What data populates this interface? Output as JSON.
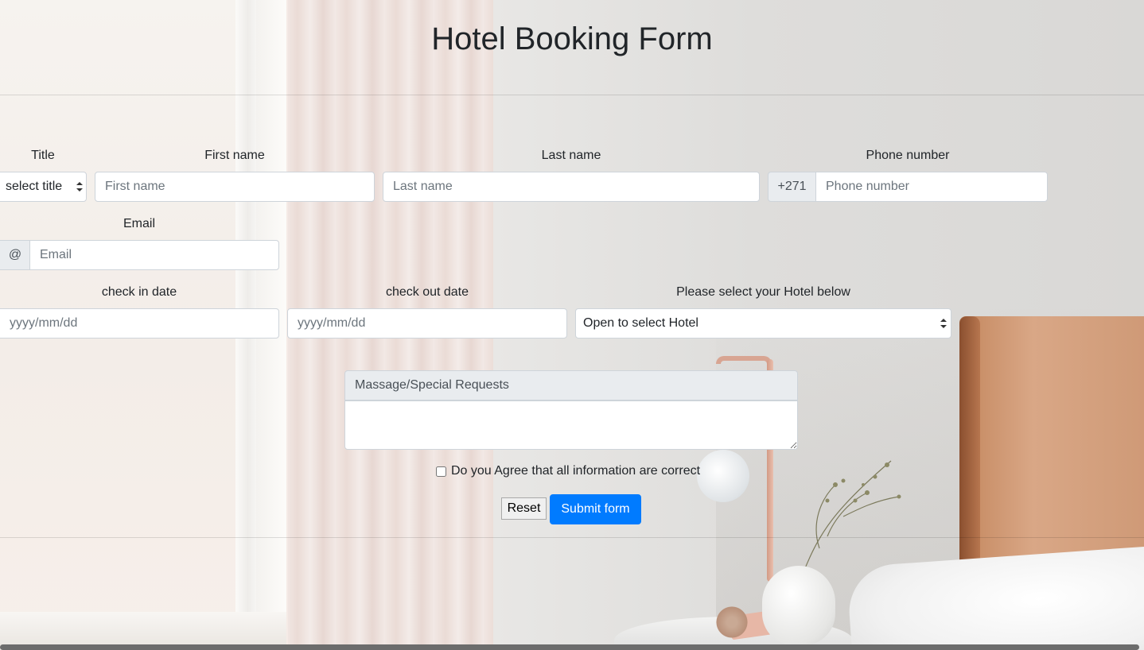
{
  "page": {
    "title": "Hotel Booking Form"
  },
  "form": {
    "title_field": {
      "label": "Title",
      "selected": "select title"
    },
    "first_name": {
      "label": "First name",
      "placeholder": "First name"
    },
    "last_name": {
      "label": "Last name",
      "placeholder": "Last name"
    },
    "phone": {
      "label": "Phone number",
      "prefix": "+271",
      "placeholder": "Phone number"
    },
    "email": {
      "label": "Email",
      "prefix": "@",
      "placeholder": "Email"
    },
    "check_in": {
      "label": "check in date",
      "placeholder": "yyyy/mm/dd"
    },
    "check_out": {
      "label": "check out date",
      "placeholder": "yyyy/mm/dd"
    },
    "hotel": {
      "label": "Please select your Hotel below",
      "selected": "Open to select Hotel"
    },
    "requests": {
      "label": "Massage/Special Requests",
      "value": ""
    },
    "agree": {
      "label": "Do you Agree that all information are correct",
      "checked": false
    },
    "buttons": {
      "reset": "Reset",
      "submit": "Submit form"
    }
  },
  "colors": {
    "primary": "#007bff",
    "addon_bg": "#e9ecef",
    "border": "#ced4da",
    "text": "#212529"
  },
  "icons": {
    "select_caret": "updown-caret-icon"
  }
}
